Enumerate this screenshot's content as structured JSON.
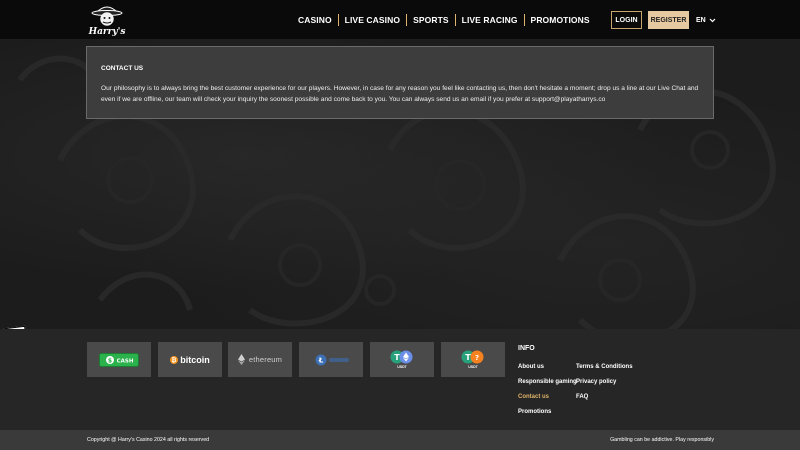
{
  "header": {
    "logo_alt": "Harry's",
    "nav": [
      "CASINO",
      "LIVE CASINO",
      "SPORTS",
      "LIVE RACING",
      "PROMOTIONS"
    ],
    "login_label": "LOGIN",
    "register_label": "REGISTER",
    "language": "EN"
  },
  "contact": {
    "title": "CONTACT US",
    "body": "Our philosophy is to always bring the best customer experience for our players. However, in case for any reason you feel like contacting us, then don't hesitate a moment; drop us a line at our Live Chat and even if we are offline, our team will check your inquiry the soonest possible and come back to you. You can always send us an email if you prefer at support@playatharrys.co"
  },
  "payments": {
    "cash_label": "CASH",
    "bitcoin_label": "bitcoin",
    "ethereum_label": "ethereum",
    "usdt_label": "USDT"
  },
  "info": {
    "title": "INFO",
    "links_left": [
      "About us",
      "Responsible gaming",
      "Contact us",
      "Promotions"
    ],
    "links_right": [
      "Terms & Conditions",
      "Privacy policy",
      "FAQ"
    ]
  },
  "bottom": {
    "copyright": "Copyright @ Harry's Casino 2024 all rights reserved",
    "responsible": "Gambling can be addictive. Play responsibly"
  },
  "colors": {
    "accent": "#e0b36a",
    "register_bg": "#e6c9a0",
    "card_bg": "#3d3d3d",
    "footer_bg": "#262626",
    "tether_green": "#26a17b",
    "cash_green": "#2bb24c",
    "bitcoin_orange": "#f7931a"
  }
}
